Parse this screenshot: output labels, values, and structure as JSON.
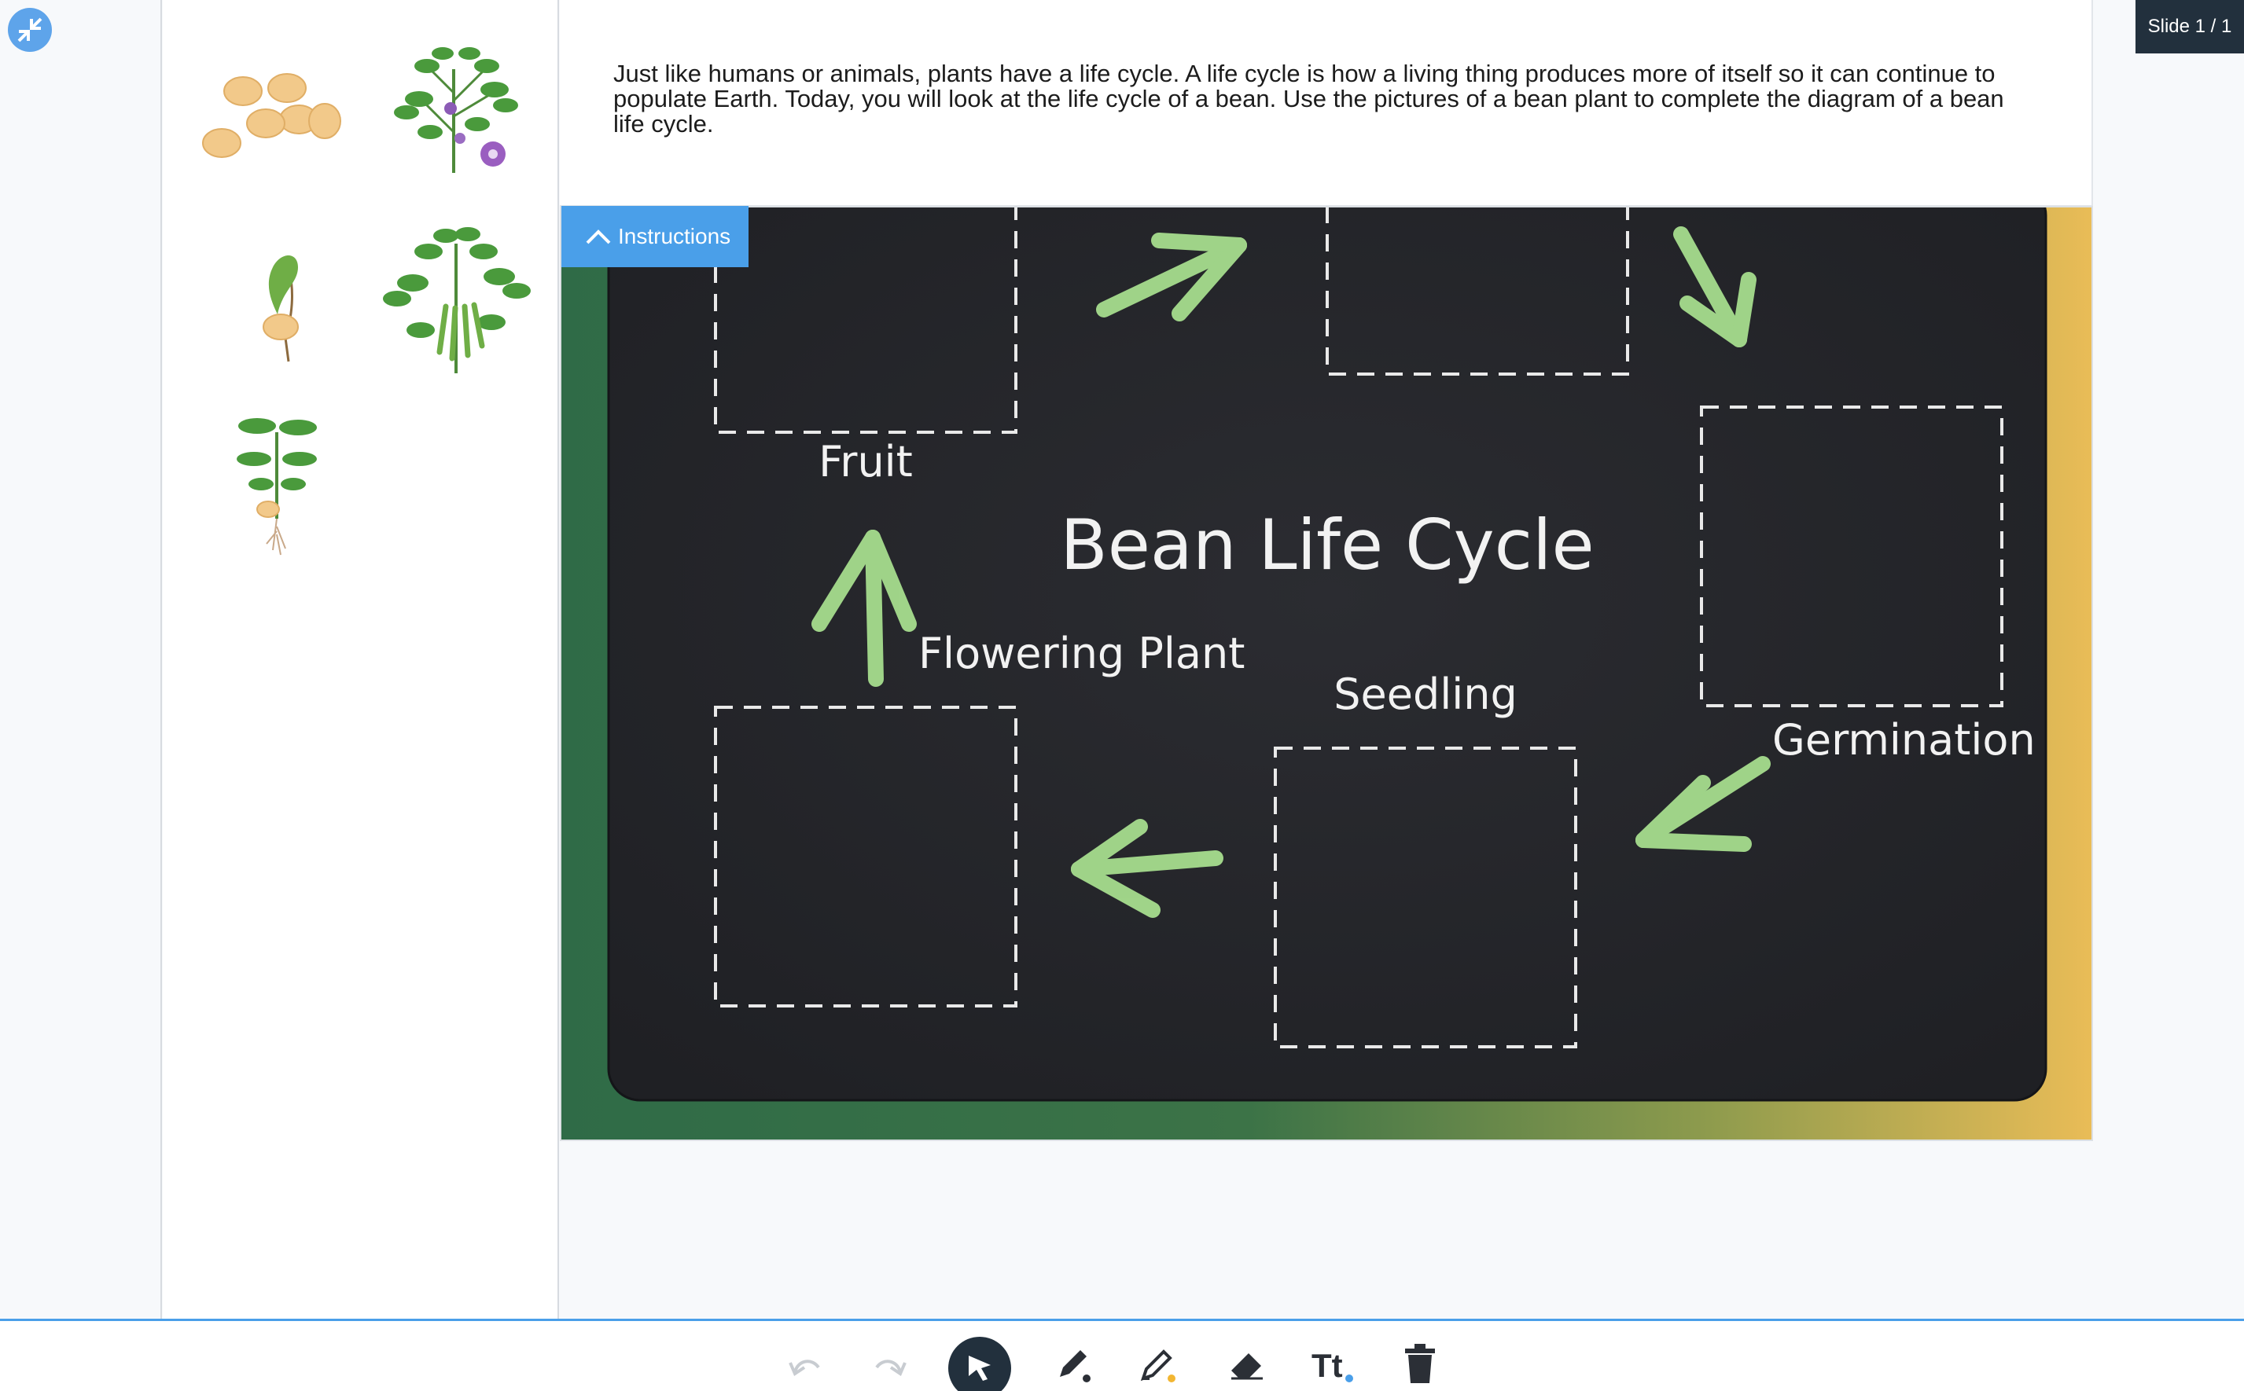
{
  "prompt": {
    "text": "Just like humans or animals, plants have a life cycle. A life cycle is how a living thing produces more of itself so it can continue to populate Earth. Today, you will look at the life cycle of a bean. Use the pictures of a bean plant to complete the diagram of a bean life cycle."
  },
  "slide_indicator": "Slide 1 / 1",
  "instructions_label": "Instructions",
  "board": {
    "title": "Bean Life Cycle",
    "labels": {
      "fruit": "Fruit",
      "flowering_plant": "Flowering Plant",
      "seedling": "Seedling",
      "germination": "Germination"
    }
  },
  "stickers": [
    "seeds",
    "flowering-plant",
    "germinating-seed",
    "fruiting-plant",
    "seedling"
  ],
  "toolbar": [
    "undo",
    "redo",
    "select",
    "pen",
    "highlighter",
    "eraser",
    "text",
    "delete"
  ],
  "colors": {
    "accent": "#4a9fe9",
    "chalk_green": "#a6dd8e",
    "chalkboard": "#26272b",
    "dark_badge": "#22303d"
  }
}
